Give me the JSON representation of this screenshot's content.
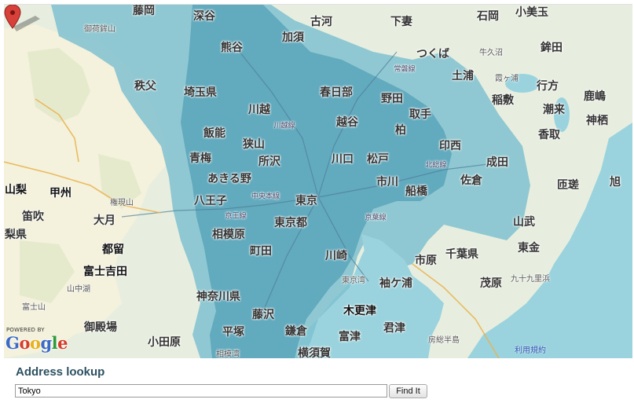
{
  "map": {
    "place_labels": [
      {
        "id": "fujioka",
        "text": "藤岡",
        "cls": "big"
      },
      {
        "id": "fukaya",
        "text": "深谷",
        "cls": "big"
      },
      {
        "id": "koga",
        "text": "古河",
        "cls": "big"
      },
      {
        "id": "shimotsuma",
        "text": "下妻",
        "cls": "big"
      },
      {
        "id": "ishioka",
        "text": "石岡",
        "cls": "big"
      },
      {
        "id": "omitama",
        "text": "小美玉",
        "cls": "big"
      },
      {
        "id": "mikabosan",
        "text": "御荷鉾山",
        "cls": "small"
      },
      {
        "id": "kazo",
        "text": "加須",
        "cls": "big"
      },
      {
        "id": "kumagaya",
        "text": "熊谷",
        "cls": "big"
      },
      {
        "id": "tsukuba",
        "text": "つくば",
        "cls": "big"
      },
      {
        "id": "hokota",
        "text": "鉾田",
        "cls": "big"
      },
      {
        "id": "chichibu",
        "text": "秩父",
        "cls": "big"
      },
      {
        "id": "saitama-ken",
        "text": "埼玉県",
        "cls": "big"
      },
      {
        "id": "kasukabe",
        "text": "春日部",
        "cls": "big"
      },
      {
        "id": "noda",
        "text": "野田",
        "cls": "big"
      },
      {
        "id": "tsuchiura",
        "text": "土浦",
        "cls": "big"
      },
      {
        "id": "namegata",
        "text": "行方",
        "cls": "big"
      },
      {
        "id": "kashima",
        "text": "鹿嶋",
        "cls": "big"
      },
      {
        "id": "kawagoe",
        "text": "川越",
        "cls": "big"
      },
      {
        "id": "koshigaya",
        "text": "越谷",
        "cls": "big"
      },
      {
        "id": "toride",
        "text": "取手",
        "cls": "big"
      },
      {
        "id": "inashiki",
        "text": "稲敷",
        "cls": "big"
      },
      {
        "id": "itako",
        "text": "潮来",
        "cls": "big"
      },
      {
        "id": "kamisu",
        "text": "神栖",
        "cls": "big"
      },
      {
        "id": "hanno",
        "text": "飯能",
        "cls": "big"
      },
      {
        "id": "kashiwa",
        "text": "柏",
        "cls": "big"
      },
      {
        "id": "inzai",
        "text": "印西",
        "cls": "big"
      },
      {
        "id": "katori",
        "text": "香取",
        "cls": "big"
      },
      {
        "id": "sayama",
        "text": "狭山",
        "cls": "big"
      },
      {
        "id": "ome",
        "text": "青梅",
        "cls": "big"
      },
      {
        "id": "tokorozawa",
        "text": "所沢",
        "cls": "big"
      },
      {
        "id": "kawaguchi",
        "text": "川口",
        "cls": "big"
      },
      {
        "id": "matsudo",
        "text": "松戸",
        "cls": "big"
      },
      {
        "id": "narita",
        "text": "成田",
        "cls": "big"
      },
      {
        "id": "akiruno",
        "text": "あきる野",
        "cls": "big"
      },
      {
        "id": "ichikawa",
        "text": "市川",
        "cls": "big"
      },
      {
        "id": "funabashi",
        "text": "船橋",
        "cls": "big"
      },
      {
        "id": "sakura",
        "text": "佐倉",
        "cls": "big"
      },
      {
        "id": "sosa",
        "text": "匝瑳",
        "cls": "big"
      },
      {
        "id": "asahi",
        "text": "旭",
        "cls": "big"
      },
      {
        "id": "yamanashi",
        "text": "山梨",
        "cls": "dark"
      },
      {
        "id": "koshu",
        "text": "甲州",
        "cls": "dark"
      },
      {
        "id": "hachioji",
        "text": "八王子",
        "cls": "big"
      },
      {
        "id": "tokyo",
        "text": "東京",
        "cls": "big"
      },
      {
        "id": "fuefuki",
        "text": "笛吹",
        "cls": "big"
      },
      {
        "id": "otsuki",
        "text": "大月",
        "cls": "big"
      },
      {
        "id": "gongendake",
        "text": "権現山",
        "cls": "small"
      },
      {
        "id": "tokyo-to",
        "text": "東京都",
        "cls": "big"
      },
      {
        "id": "sammu",
        "text": "山武",
        "cls": "big"
      },
      {
        "id": "yamanashi-ken",
        "text": "梨県",
        "cls": "big"
      },
      {
        "id": "sagamihara",
        "text": "相模原",
        "cls": "big"
      },
      {
        "id": "tsuru",
        "text": "都留",
        "cls": "dark"
      },
      {
        "id": "machida",
        "text": "町田",
        "cls": "big"
      },
      {
        "id": "kawasaki",
        "text": "川崎",
        "cls": "big"
      },
      {
        "id": "ichihara",
        "text": "市原",
        "cls": "big"
      },
      {
        "id": "chiba-ken",
        "text": "千葉県",
        "cls": "big"
      },
      {
        "id": "togane",
        "text": "東金",
        "cls": "big"
      },
      {
        "id": "fujiyoshida",
        "text": "富士吉田",
        "cls": "dark"
      },
      {
        "id": "kujukuri",
        "text": "九十九里浜",
        "cls": "small"
      },
      {
        "id": "kisarazu",
        "text": "木更津",
        "cls": "dark"
      },
      {
        "id": "kanagawa-ken",
        "text": "神奈川県",
        "cls": "big"
      },
      {
        "id": "sodegaura",
        "text": "袖ケ浦",
        "cls": "big"
      },
      {
        "id": "mobara",
        "text": "茂原",
        "cls": "big"
      },
      {
        "id": "fujisan",
        "text": "富士山",
        "cls": "small"
      },
      {
        "id": "fujisawa",
        "text": "藤沢",
        "cls": "big"
      },
      {
        "id": "kimitsu",
        "text": "君津",
        "cls": "big"
      },
      {
        "id": "gotemba",
        "text": "御殿場",
        "cls": "big"
      },
      {
        "id": "hiratsuka",
        "text": "平塚",
        "cls": "big"
      },
      {
        "id": "kamakura",
        "text": "鎌倉",
        "cls": "big"
      },
      {
        "id": "futtsu",
        "text": "富津",
        "cls": "big"
      },
      {
        "id": "odawara",
        "text": "小田原",
        "cls": "big"
      },
      {
        "id": "yokosuka",
        "text": "横須賀",
        "cls": "big"
      },
      {
        "id": "sagamiwan",
        "text": "相模湾",
        "cls": "small"
      },
      {
        "id": "boso",
        "text": "房総半島",
        "cls": "small"
      },
      {
        "id": "nakaichi",
        "text": "中央本線",
        "cls": "road"
      },
      {
        "id": "joban",
        "text": "常磐線",
        "cls": "road"
      },
      {
        "id": "keiyo",
        "text": "京葉線",
        "cls": "road"
      },
      {
        "id": "hokuso",
        "text": "北総線",
        "cls": "road"
      },
      {
        "id": "kawagoe-line",
        "text": "川越線",
        "cls": "road"
      },
      {
        "id": "keio",
        "text": "京王線",
        "cls": "road"
      },
      {
        "id": "yamanashi-small",
        "text": "山中湖",
        "cls": "small"
      },
      {
        "id": "tokyowan",
        "text": "東京湾",
        "cls": "small"
      },
      {
        "id": "ushiku",
        "text": "牛久沼",
        "cls": "small"
      },
      {
        "id": "kasumi",
        "text": "霞ヶ浦",
        "cls": "small"
      }
    ]
  },
  "attribution": {
    "powered_by": "POWERED BY",
    "google_letters": [
      "G",
      "o",
      "o",
      "g",
      "l",
      "e"
    ],
    "terms": "利用規約"
  },
  "lookup": {
    "title": "Address lookup",
    "input_value": "Tokyo",
    "button_label": "Find It"
  },
  "colors": {
    "water": "#9ad3de",
    "land": "#e7eedf",
    "mountain": "#f4f1dc",
    "outer_coverage": "#7fc1d0",
    "inner_coverage": "#5aa5bb",
    "marker": "#d8403a",
    "title": "#2c5161"
  },
  "icons": {
    "marker": "map-pin-icon"
  }
}
